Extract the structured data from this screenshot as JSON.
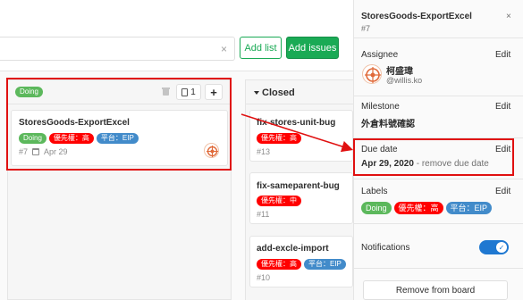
{
  "toolbar": {
    "clear_icon": "×",
    "add_list_label": "Add list",
    "add_issues_label": "Add issues"
  },
  "lists": {
    "doing": {
      "label": "Doing",
      "count": "1",
      "add_icon": "+"
    },
    "closed": {
      "title": "Closed"
    }
  },
  "main_card": {
    "title": "StoresGoods-ExportExcel",
    "labels": [
      "Doing",
      "優先權：高",
      "平台：EIP"
    ],
    "number": "#7",
    "due": "Apr 29"
  },
  "closed_cards": [
    {
      "title": "fix-stores-unit-bug",
      "labels": [
        "優先權：高"
      ],
      "number": "#13"
    },
    {
      "title": "fix-sameparent-bug",
      "labels": [
        "優先權：中"
      ],
      "number": "#11"
    },
    {
      "title": "add-excle-import",
      "labels": [
        "優先權：高",
        "平台：EIP"
      ],
      "number": "#10"
    }
  ],
  "sidebar": {
    "title": "StoresGoods-ExportExcel",
    "number": "#7",
    "close_icon": "×",
    "assignee": {
      "label": "Assignee",
      "edit": "Edit",
      "name": "柯盛瑋",
      "username": "@willis.ko"
    },
    "milestone": {
      "label": "Milestone",
      "edit": "Edit",
      "value": "外倉料號確認"
    },
    "due_date": {
      "label": "Due date",
      "edit": "Edit",
      "value": "Apr 29, 2020",
      "remove": " - remove due date"
    },
    "labels": {
      "label": "Labels",
      "edit": "Edit",
      "items": [
        "Doing",
        "優先權：高",
        "平台：EIP"
      ]
    },
    "notifications": {
      "label": "Notifications",
      "enabled": true,
      "check_icon": "✓"
    },
    "remove_label": "Remove from board"
  },
  "colors": {
    "green": "#1aaa55",
    "doing": "#5cb85c",
    "priority": "#ff0000",
    "platform": "#428bca",
    "toggle": "#1f78d1",
    "annotation": "#e01010"
  }
}
